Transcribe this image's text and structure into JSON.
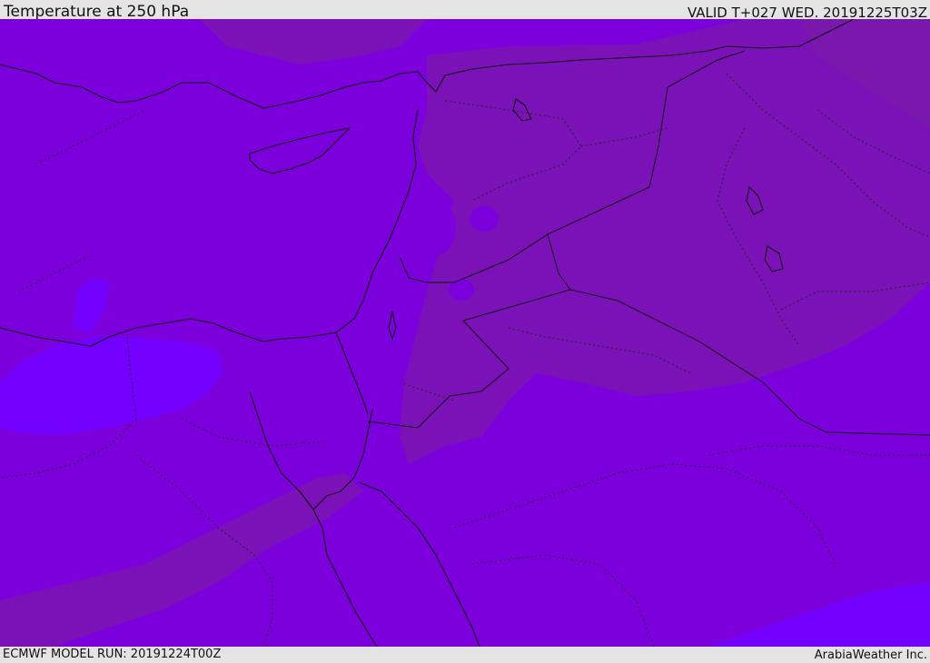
{
  "header": {
    "title": "Temperature at 250 hPa",
    "valid": "VALID T+027 WED. 20191225T03Z"
  },
  "footer": {
    "model_run": "ECMWF MODEL RUN: 20191224T00Z",
    "credit": "ArabiaWeather Inc."
  },
  "colors": {
    "base": "#7c00dc",
    "warm": "#7a12b8",
    "warmer": "#7a1ca6",
    "cold": "#7300ff",
    "coldest": "#6b1aff",
    "border": "#111111"
  }
}
